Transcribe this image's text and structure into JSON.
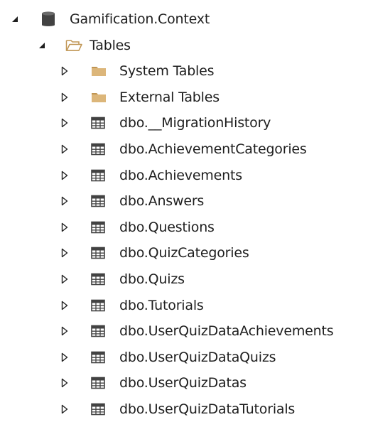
{
  "tree": {
    "root": {
      "label": "Gamification.Context",
      "icon": "database-icon",
      "expanded": true
    },
    "tables_folder": {
      "label": "Tables",
      "icon": "folder-open-icon",
      "expanded": true
    },
    "folders": [
      {
        "label": "System Tables",
        "icon": "folder-icon",
        "expanded": false
      },
      {
        "label": "External Tables",
        "icon": "folder-icon",
        "expanded": false
      }
    ],
    "tables": [
      {
        "label": "dbo.__MigrationHistory",
        "icon": "table-icon",
        "expanded": false
      },
      {
        "label": "dbo.AchievementCategories",
        "icon": "table-icon",
        "expanded": false
      },
      {
        "label": "dbo.Achievements",
        "icon": "table-icon",
        "expanded": false
      },
      {
        "label": "dbo.Answers",
        "icon": "table-icon",
        "expanded": false
      },
      {
        "label": "dbo.Questions",
        "icon": "table-icon",
        "expanded": false
      },
      {
        "label": "dbo.QuizCategories",
        "icon": "table-icon",
        "expanded": false
      },
      {
        "label": "dbo.Quizs",
        "icon": "table-icon",
        "expanded": false
      },
      {
        "label": "dbo.Tutorials",
        "icon": "table-icon",
        "expanded": false
      },
      {
        "label": "dbo.UserQuizDataAchievements",
        "icon": "table-icon",
        "expanded": false
      },
      {
        "label": "dbo.UserQuizDataQuizs",
        "icon": "table-icon",
        "expanded": false
      },
      {
        "label": "dbo.UserQuizDatas",
        "icon": "table-icon",
        "expanded": false
      },
      {
        "label": "dbo.UserQuizDataTutorials",
        "icon": "table-icon",
        "expanded": false
      }
    ]
  },
  "colors": {
    "text": "#1e1e1e",
    "folder": "#dcb67a",
    "folder_dark": "#c09553",
    "database": "#424242",
    "table_grid": "#424242",
    "arrow": "#1e1e1e"
  }
}
